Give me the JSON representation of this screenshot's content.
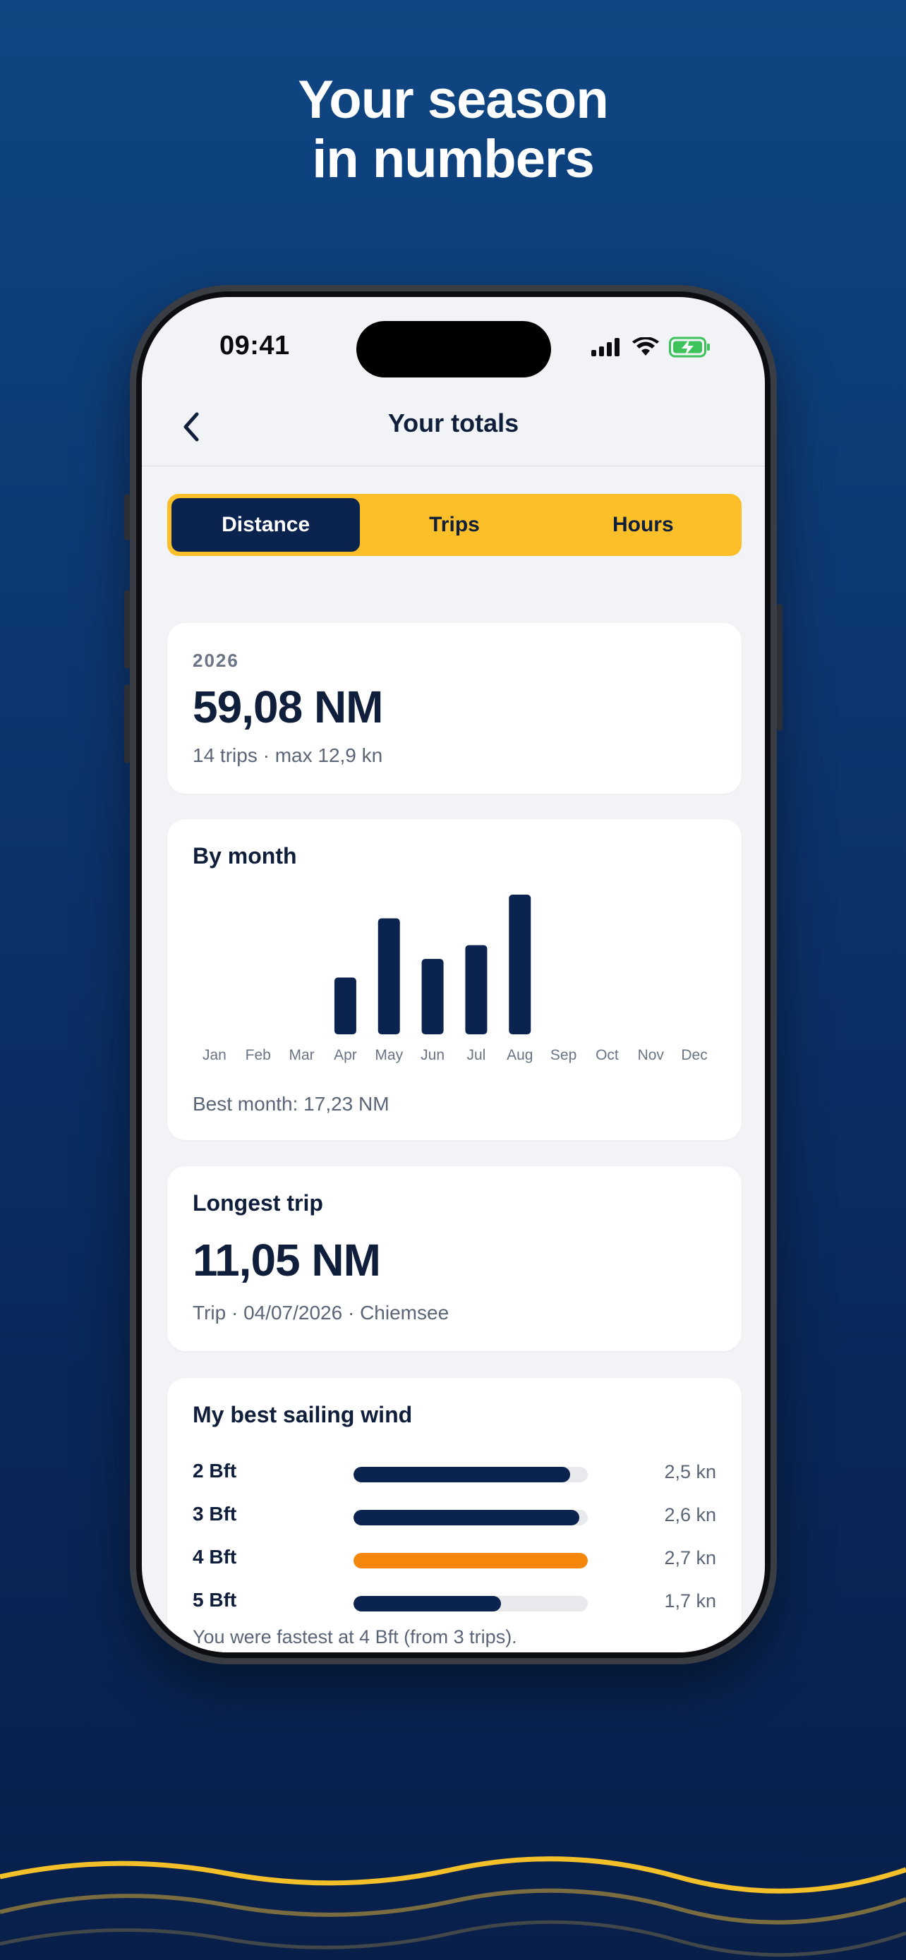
{
  "headline": {
    "line1": "Your season",
    "line2": "in numbers"
  },
  "status": {
    "time": "09:41"
  },
  "nav": {
    "title": "Your totals",
    "back_icon": "chevron-left-icon"
  },
  "tabs": [
    {
      "label": "Distance",
      "active": true
    },
    {
      "label": "Trips",
      "active": false
    },
    {
      "label": "Hours",
      "active": false
    }
  ],
  "summary": {
    "year": "2026",
    "distance": "59,08 NM",
    "subtitle": "14 trips · max 12,9 kn"
  },
  "by_month": {
    "title": "By month",
    "best": "Best month: 17,23 NM",
    "bar_color": "#0b234f"
  },
  "chart_data": {
    "type": "bar",
    "categories": [
      "Jan",
      "Feb",
      "Mar",
      "Apr",
      "May",
      "Jun",
      "Jul",
      "Aug",
      "Sep",
      "Oct",
      "Nov",
      "Dec"
    ],
    "values": [
      0,
      0,
      0,
      7.0,
      14.3,
      9.3,
      11.0,
      17.23,
      0,
      0,
      0,
      0
    ],
    "ylim": [
      0,
      17.23
    ]
  },
  "longest": {
    "title": "Longest trip",
    "distance": "11,05 NM",
    "subtitle": "Trip · 04/07/2026 · Chiemsee"
  },
  "wind": {
    "title": "My best sailing wind",
    "rows": [
      {
        "label": "2 Bft",
        "value": "2,5 kn",
        "fraction": 0.926,
        "highlight": false
      },
      {
        "label": "3 Bft",
        "value": "2,6 kn",
        "fraction": 0.963,
        "highlight": false
      },
      {
        "label": "4 Bft",
        "value": "2,7 kn",
        "fraction": 1.0,
        "highlight": true
      },
      {
        "label": "5 Bft",
        "value": "1,7 kn",
        "fraction": 0.63,
        "highlight": false
      }
    ],
    "footnote": "You were fastest at 4 Bft (from 3 trips).",
    "colors": {
      "bar": "#0b234f",
      "highlight": "#f5870c"
    }
  }
}
